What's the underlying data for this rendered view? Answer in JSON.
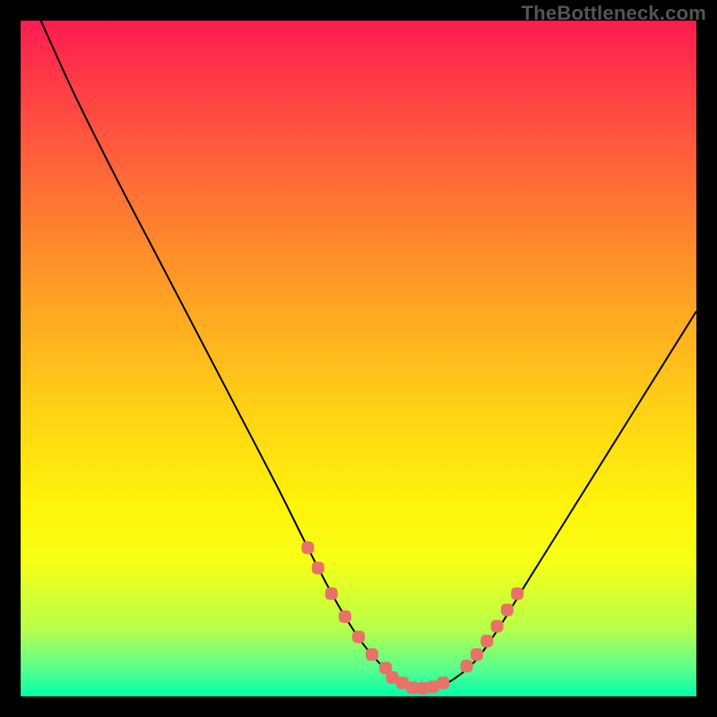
{
  "watermark": "TheBottleneck.com",
  "chart_data": {
    "type": "line",
    "title": "",
    "xlabel": "",
    "ylabel": "",
    "xlim": [
      0,
      100
    ],
    "ylim": [
      0,
      100
    ],
    "curve_left": {
      "x": [
        3,
        8,
        14,
        20,
        26,
        32,
        38,
        43,
        47,
        50.5,
        53.5,
        56,
        58
      ],
      "y": [
        100,
        89,
        77,
        65.5,
        54,
        42.5,
        31,
        21,
        13.5,
        8,
        4.5,
        2.2,
        1
      ]
    },
    "curve_right": {
      "x": [
        58,
        61,
        64,
        67.5,
        71,
        75,
        80,
        85,
        90,
        95,
        100
      ],
      "y": [
        1,
        1.2,
        2.5,
        5.5,
        10.5,
        17,
        25,
        33,
        41,
        49,
        57
      ]
    },
    "markers_left": {
      "x": [
        42.5,
        44,
        46,
        48,
        50,
        52,
        54
      ],
      "y": [
        22,
        19,
        15.2,
        11.8,
        8.8,
        6.2,
        4.2
      ]
    },
    "markers_bottom": {
      "x": [
        55,
        56.5,
        58,
        59.5,
        61,
        62.5
      ],
      "y": [
        2.8,
        2.0,
        1.3,
        1.2,
        1.4,
        2.0
      ]
    },
    "markers_right": {
      "x": [
        66,
        67.5,
        69,
        70.5,
        72,
        73.5
      ],
      "y": [
        4.5,
        6.2,
        8.2,
        10.4,
        12.8,
        15.2
      ]
    }
  }
}
